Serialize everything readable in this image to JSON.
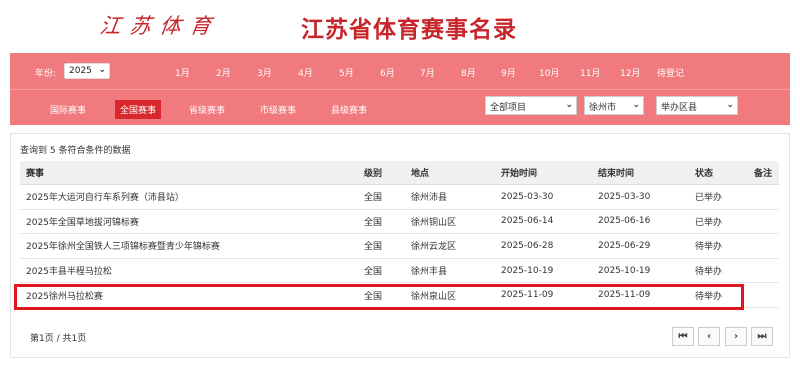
{
  "header": {
    "logo_text": "江苏体育",
    "title": "江苏省体育赛事名录"
  },
  "filters": {
    "year_label": "年份:",
    "year_value": "2025",
    "months": [
      "1月",
      "2月",
      "3月",
      "4月",
      "5月",
      "6月",
      "7月",
      "8月",
      "9月",
      "10月",
      "11月",
      "12月",
      "待登记"
    ],
    "categories": [
      "国际赛事",
      "全国赛事",
      "省级赛事",
      "市级赛事",
      "县级赛事"
    ],
    "active_category": "全国赛事",
    "project_select": "全部项目",
    "city_select": "徐州市",
    "district_select": "举办区县"
  },
  "results": {
    "summary": "查询到 5 条符合条件的数据",
    "columns": [
      "赛事",
      "级别",
      "地点",
      "开始时间",
      "结束时间",
      "状态",
      "备注"
    ],
    "rows": [
      {
        "name": "2025年大运河自行车系列赛（沛县站）",
        "level": "全国",
        "place": "徐州沛县",
        "start": "2025-03-30",
        "end": "2025-03-30",
        "status": "已举办",
        "note": ""
      },
      {
        "name": "2025年全国草地拔河锦标赛",
        "level": "全国",
        "place": "徐州铜山区",
        "start": "2025-06-14",
        "end": "2025-06-16",
        "status": "已举办",
        "note": ""
      },
      {
        "name": "2025年徐州全国铁人三项锦标赛暨青少年锦标赛",
        "level": "全国",
        "place": "徐州云龙区",
        "start": "2025-06-28",
        "end": "2025-06-29",
        "status": "待举办",
        "note": ""
      },
      {
        "name": "2025丰县半程马拉松",
        "level": "全国",
        "place": "徐州丰县",
        "start": "2025-10-19",
        "end": "2025-10-19",
        "status": "待举办",
        "note": ""
      },
      {
        "name": "2025徐州马拉松赛",
        "level": "全国",
        "place": "徐州泉山区",
        "start": "2025-11-09",
        "end": "2025-11-09",
        "status": "待举办",
        "note": ""
      }
    ]
  },
  "pager": {
    "text": "第1页 / 共1页",
    "first": "⏮",
    "prev": "‹",
    "next": "›",
    "last": "⏭"
  },
  "colors": {
    "brand_red": "#c8252b",
    "panel_red": "#f07a7d",
    "active_red": "#d9282d",
    "highlight_red": "#e0161d"
  }
}
